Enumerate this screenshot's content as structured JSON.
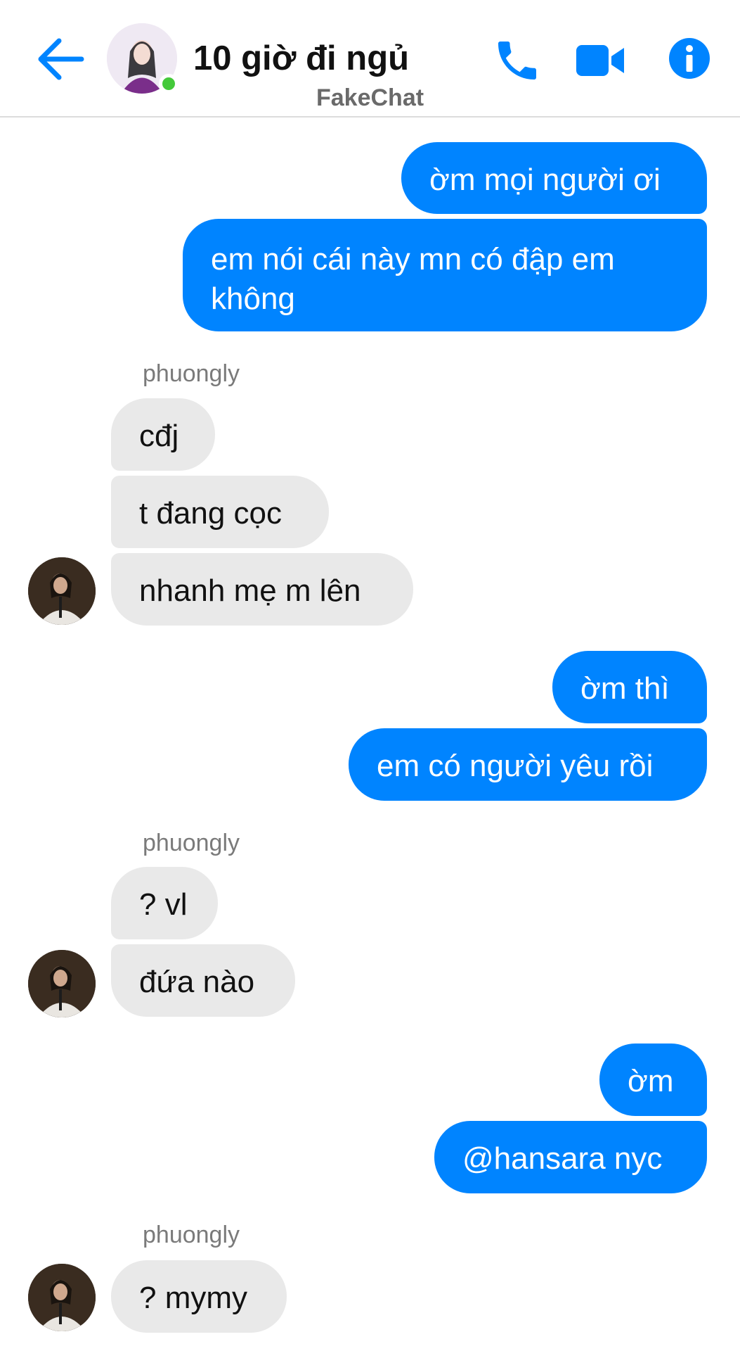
{
  "header": {
    "title": "10 giờ đi ngủ",
    "subtitle": "FakeChat",
    "accent_color": "#0084ff",
    "online_color": "#44c93a",
    "icons": [
      "arrow-back-icon",
      "phone-icon",
      "video-camera-icon",
      "info-icon"
    ]
  },
  "messages": {
    "m1": "ờm mọi người ơi",
    "m2": "em nói cái này mn có đập em không",
    "s1": "phuongly",
    "m3": "cđj",
    "m4": "t đang cọc",
    "m5": "nhanh mẹ m lên",
    "m6": "ờm thì",
    "m7": "em có người yêu rồi",
    "s2": "phuongly",
    "m8": "? vl",
    "m9": "đứa nào",
    "m10": "ờm",
    "m11": "@hansara nyc",
    "s3": "phuongly",
    "m12": "? mymy"
  }
}
